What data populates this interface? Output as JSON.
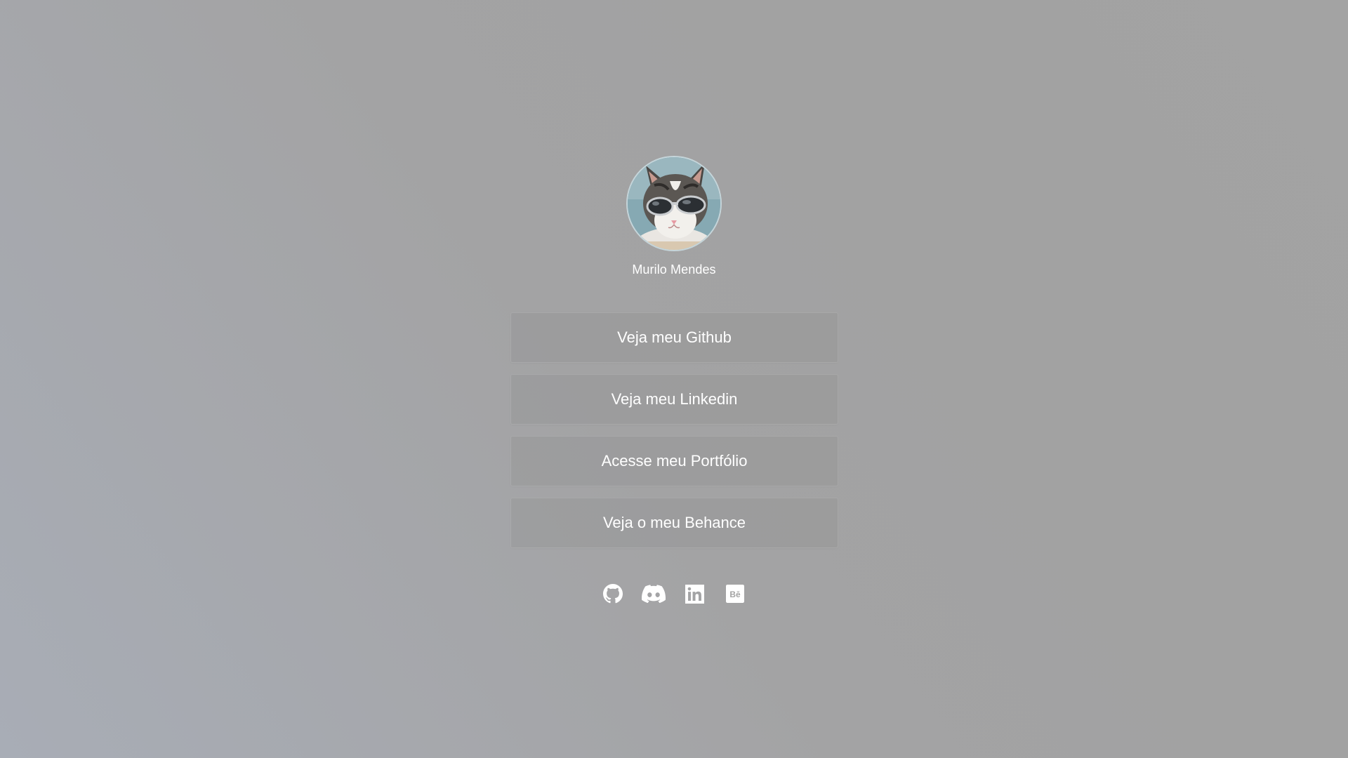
{
  "profile": {
    "name": "Murilo Mendes"
  },
  "links": [
    {
      "label": "Veja meu Github"
    },
    {
      "label": "Veja meu Linkedin"
    },
    {
      "label": "Acesse meu Portfólio"
    },
    {
      "label": "Veja o meu Behance"
    }
  ],
  "socials": [
    {
      "icon": "github-icon"
    },
    {
      "icon": "discord-icon"
    },
    {
      "icon": "linkedin-icon"
    },
    {
      "icon": "behance-icon"
    }
  ],
  "colors": {
    "text": "#ffffff",
    "background": "#a3a3a3",
    "background_accent": "#a8adb6"
  }
}
